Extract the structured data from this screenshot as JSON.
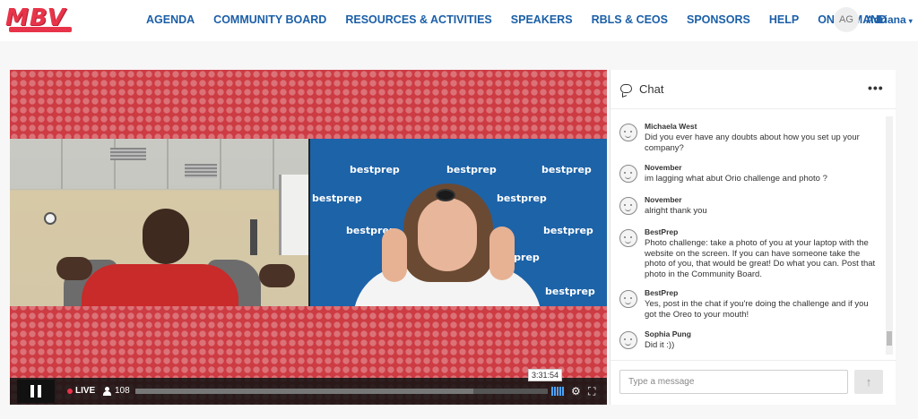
{
  "app": {
    "logo_text": "MBV"
  },
  "nav": {
    "items": [
      {
        "label": "AGENDA"
      },
      {
        "label": "COMMUNITY BOARD"
      },
      {
        "label": "RESOURCES & ACTIVITIES"
      },
      {
        "label": "SPEAKERS"
      },
      {
        "label": "RBLS & CEOS"
      },
      {
        "label": "SPONSORS"
      },
      {
        "label": "HELP"
      },
      {
        "label": "ON DEMAND"
      }
    ]
  },
  "user": {
    "initials": "AG",
    "name": "Adriana",
    "caret": "▾"
  },
  "player": {
    "live_label": "LIVE",
    "viewers": "108",
    "time": "3:31:54",
    "progress": 0.82,
    "watermark": "bestprep",
    "state": "playing"
  },
  "chat": {
    "title": "Chat",
    "menu": "•••",
    "input_placeholder": "Type a message",
    "send_icon": "↑",
    "messages": [
      {
        "author": "Michaela West",
        "text": "Did you ever have any doubts about how you set up your company?"
      },
      {
        "author": "November",
        "text": "im lagging what abut Orio challenge and photo ?"
      },
      {
        "author": "November",
        "text": "alright thank you"
      },
      {
        "author": "BestPrep",
        "text": "Photo challenge: take a photo of you at your laptop with the website on the screen. If you can have someone take the photo of you, that would be great! Do what you can. Post that photo in the Community Board."
      },
      {
        "author": "BestPrep",
        "text": "Yes, post in the chat if you're doing the challenge and if you got the Oreo to your mouth!"
      },
      {
        "author": "Sophia Pung",
        "text": "Did it :))"
      }
    ]
  },
  "colors": {
    "nav_blue": "#1b5fa8",
    "brand_red": "#e8344a",
    "player_bg": "#cd3b43"
  }
}
